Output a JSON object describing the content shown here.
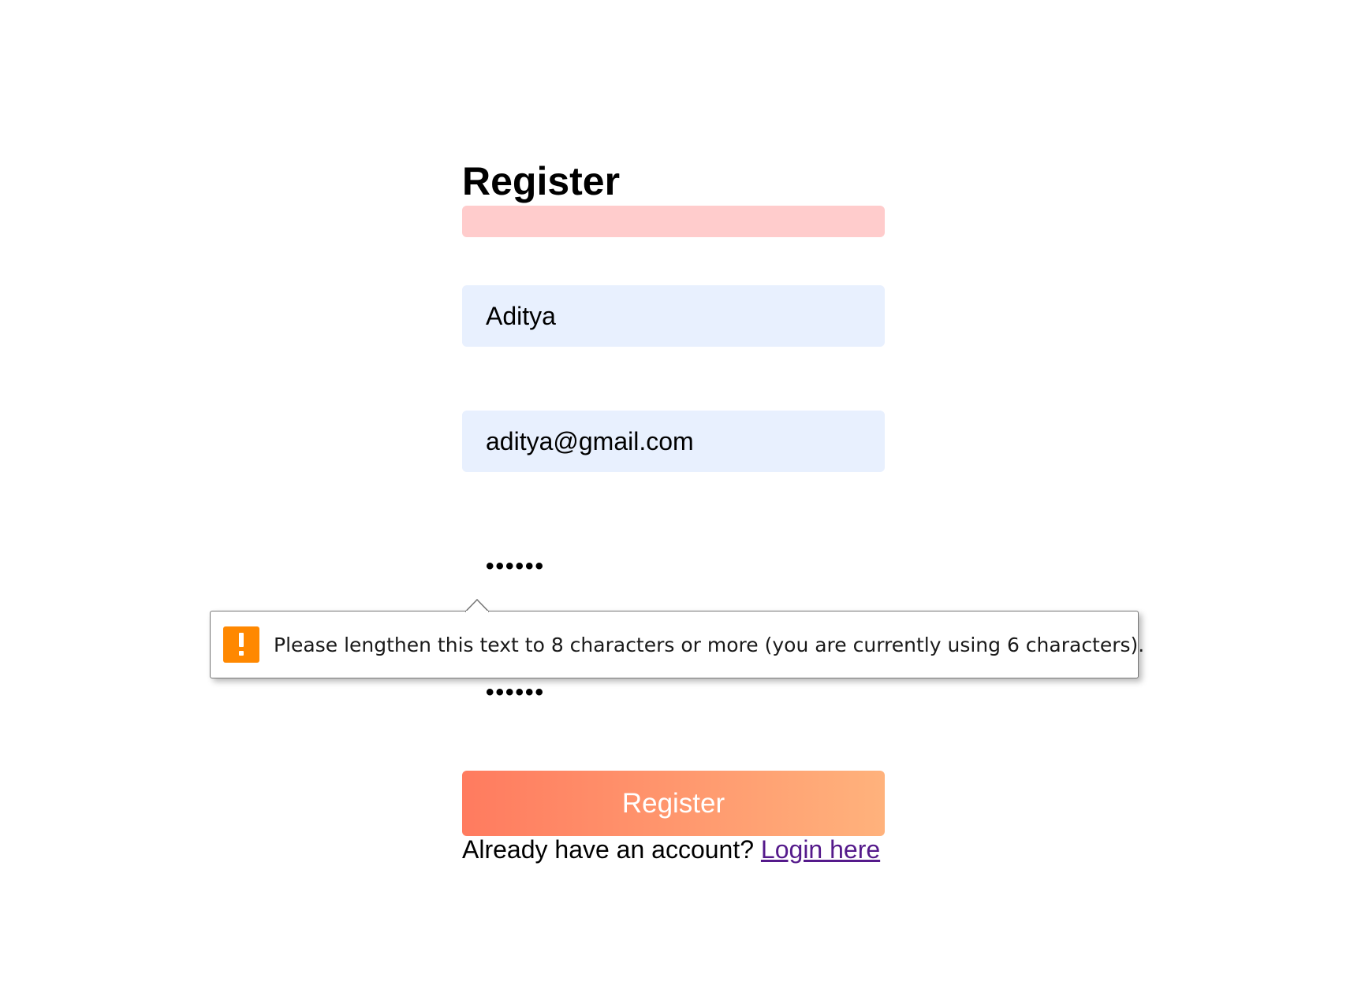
{
  "form": {
    "title": "Register",
    "name_value": "Aditya",
    "email_value": "aditya@gmail.com",
    "password_mask": "••••••",
    "confirm_password_mask": "••••••",
    "submit_label": "Register",
    "login_prompt": "Already have an account?",
    "login_link_label": "Login here"
  },
  "validation_tooltip": {
    "icon": "warning-icon",
    "message": "Please lengthen this text to 8 characters or more (you are currently using 6 characters)."
  },
  "colors": {
    "error_bar": "#ffcccc",
    "autofill_field": "#e8f0fe",
    "button_gradient_start": "#ff7b5f",
    "button_gradient_end": "#ffb27c",
    "warning_icon": "#ff8800",
    "visited_link": "#551a8b"
  }
}
